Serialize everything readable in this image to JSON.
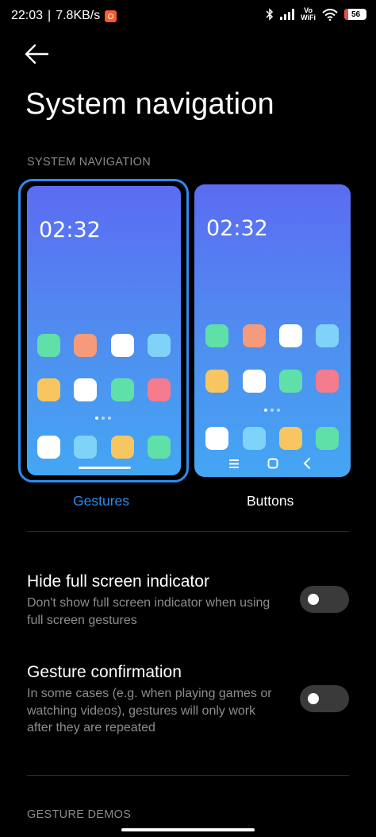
{
  "status_bar": {
    "time": "22:03",
    "speed": "7.8KB/s",
    "network_label_top": "Vo",
    "network_label_bottom": "WiFi",
    "battery": "56"
  },
  "header": {
    "title": "System navigation"
  },
  "section": {
    "label": "SYSTEM NAVIGATION"
  },
  "previews": {
    "gestures": {
      "time": "02:32",
      "label": "Gestures",
      "selected": true
    },
    "buttons": {
      "time": "02:32",
      "label": "Buttons",
      "selected": false
    },
    "colors": {
      "selected": "#2a8cf0",
      "green": "#5fe0a8",
      "orange": "#f59a7a",
      "white": "#ffffff",
      "lightblue": "#7fd3f8",
      "yellow": "#f7c660",
      "pink": "#f57b8e"
    }
  },
  "settings": [
    {
      "title": "Hide full screen indicator",
      "description": "Don't show full screen indicator when using full screen gestures",
      "enabled": false
    },
    {
      "title": "Gesture confirmation",
      "description": "In some cases (e.g. when playing games or watching videos), gestures will only work after they are repeated",
      "enabled": false
    }
  ],
  "demos": {
    "label": "GESTURE DEMOS"
  }
}
